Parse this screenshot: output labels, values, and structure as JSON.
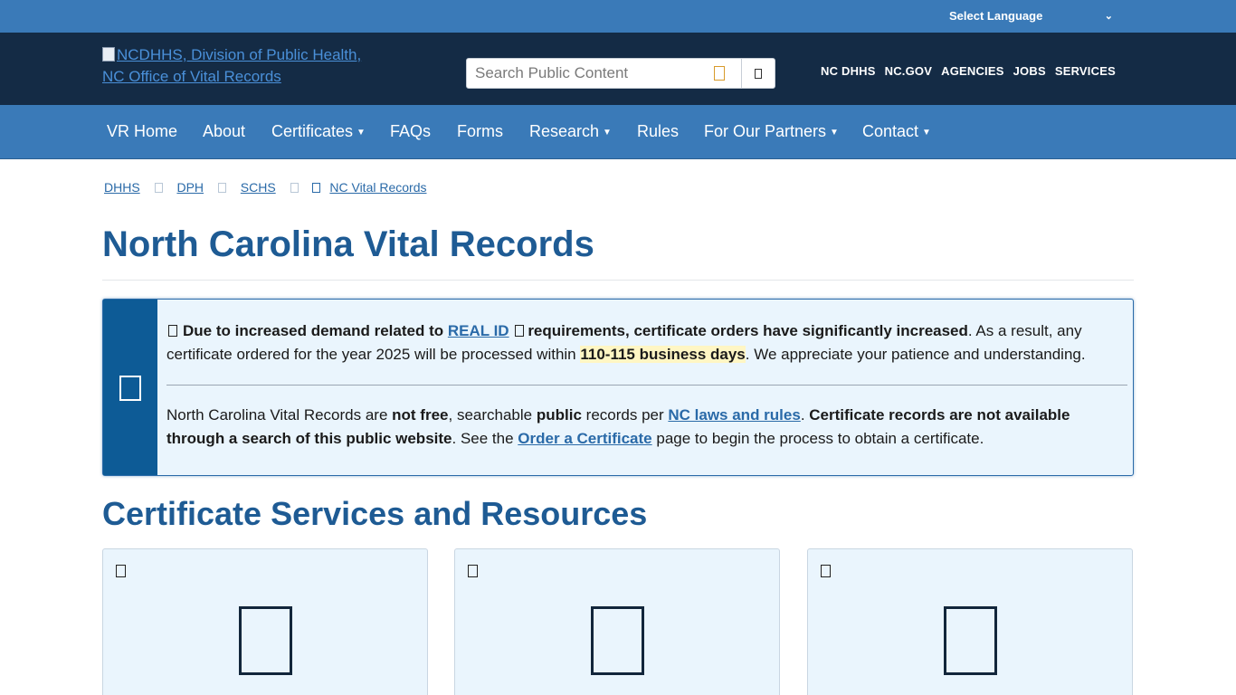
{
  "language_bar": {
    "select_label": "Select Language",
    "chevron": "chevron-down-icon"
  },
  "header": {
    "logo_alt": "NCDHHS, Division of Public Health, NC Office of Vital Records",
    "search": {
      "placeholder": "Search Public Content"
    },
    "utility_nav": [
      "NC DHHS",
      "NC.GOV",
      "AGENCIES",
      "JOBS",
      "SERVICES"
    ]
  },
  "main_nav": {
    "items": [
      {
        "label": "VR Home",
        "dropdown": false
      },
      {
        "label": "About",
        "dropdown": false
      },
      {
        "label": "Certificates",
        "dropdown": true
      },
      {
        "label": "FAQs",
        "dropdown": false
      },
      {
        "label": "Forms",
        "dropdown": false
      },
      {
        "label": "Research",
        "dropdown": true
      },
      {
        "label": "Rules",
        "dropdown": false
      },
      {
        "label": "For Our Partners",
        "dropdown": true
      },
      {
        "label": "Contact",
        "dropdown": true
      }
    ]
  },
  "breadcrumb": {
    "items": [
      "DHHS",
      "DPH",
      "SCHS",
      "NC Vital Records"
    ]
  },
  "page": {
    "title": "North Carolina Vital Records",
    "section_title": "Certificate Services and Resources"
  },
  "alert": {
    "p1_bold_a": "Due to increased demand related to",
    "p1_link": "REAL ID",
    "p1_bold_b": "requirements, certificate orders have significantly increased",
    "p1_text_a": ". As a result, any certificate ordered for the year 2025 will be processed within",
    "p1_highlight": "110-115 business days",
    "p1_text_b": ". We appreciate your patience and understanding.",
    "p2_text_a": "North Carolina Vital Records are",
    "p2_bold_a": "not free",
    "p2_text_b": ", searchable",
    "p2_bold_b": "public",
    "p2_text_c": "records per",
    "p2_link_a": "NC laws and rules",
    "p2_text_d": ".",
    "p2_bold_c": "Certificate records are not available through a search of this public website",
    "p2_text_e": ". See the",
    "p2_link_b": "Order a Certificate",
    "p2_text_f": "page to begin the process to obtain a certificate."
  },
  "colors": {
    "primary_blue": "#3a7ab8",
    "header_navy": "#142b45",
    "title_blue": "#1e5b94",
    "alert_bg": "#eaf5fd"
  }
}
